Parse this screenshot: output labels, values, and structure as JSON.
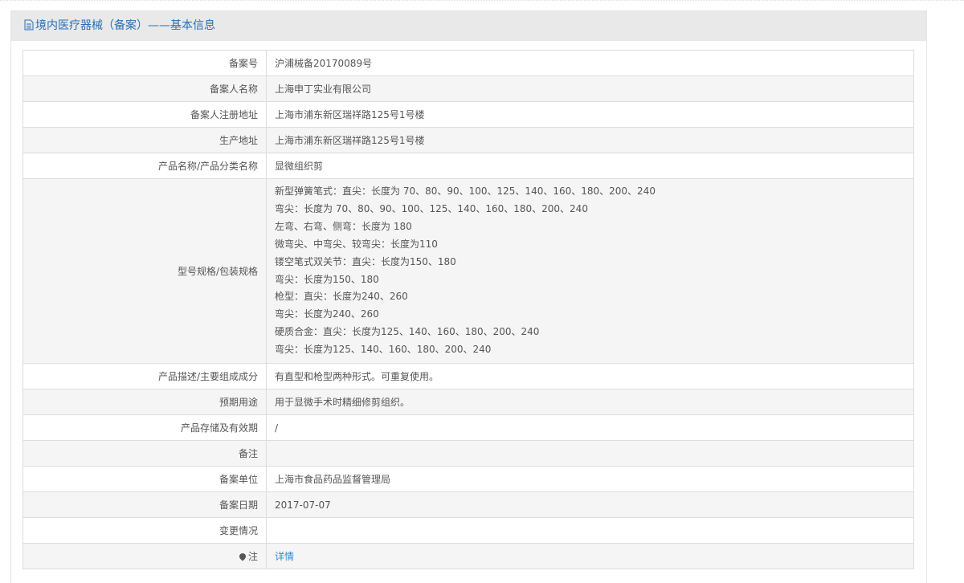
{
  "header": {
    "title": "境内医疗器械（备案）——基本信息",
    "icon": "document-icon"
  },
  "rows": [
    {
      "label": "备案号",
      "value": "沪浦械备20170089号"
    },
    {
      "label": "备案人名称",
      "value": "上海申丁实业有限公司"
    },
    {
      "label": "备案人注册地址",
      "value": "上海市浦东新区瑞祥路125号1号楼"
    },
    {
      "label": "生产地址",
      "value": "上海市浦东新区瑞祥路125号1号楼"
    },
    {
      "label": "产品名称/产品分类名称",
      "value": "显微组织剪"
    },
    {
      "label": "型号规格/包装规格",
      "lines": [
        "新型弹簧笔式：直尖：长度为 70、80、90、100、125、140、160、180、200、240",
        "弯尖：长度为 70、80、90、100、125、140、160、180、200、240",
        "左弯、右弯、侧弯：长度为 180",
        "微弯尖、中弯尖、较弯尖：长度为110",
        "镂空笔式双关节：直尖：长度为150、180",
        "弯尖：长度为150、180",
        "枪型：直尖：长度为240、260",
        "弯尖：长度为240、260",
        "硬质合金：直尖：长度为125、140、160、180、200、240",
        "弯尖：长度为125、140、160、180、200、240"
      ]
    },
    {
      "label": "产品描述/主要组成成分",
      "value": "有直型和枪型两种形式。可重复使用。"
    },
    {
      "label": "预期用途",
      "value": "用于显微手术时精细修剪组织。"
    },
    {
      "label": "产品存储及有效期",
      "value": "/"
    },
    {
      "label": "备注",
      "value": ""
    },
    {
      "label": "备案单位",
      "value": "上海市食品药品监督管理局"
    },
    {
      "label": "备案日期",
      "value": "2017-07-07"
    },
    {
      "label": "变更情况",
      "value": ""
    },
    {
      "label": "注",
      "value": "详情"
    }
  ]
}
